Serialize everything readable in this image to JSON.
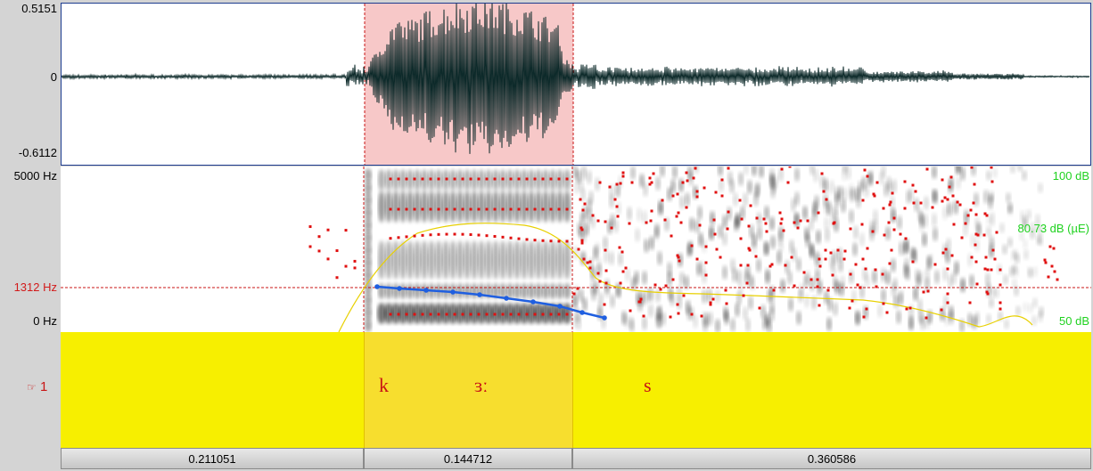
{
  "waveform": {
    "y_max": "0.5151",
    "y_zero": "0",
    "y_min": "-0.6112"
  },
  "spectrogram": {
    "freq_top": "5000 Hz",
    "freq_cursor": "1312 Hz",
    "freq_bottom": "0 Hz",
    "db_top": "100 dB",
    "db_mid": "80.73 dB (µE)",
    "db_bottom": "50 dB"
  },
  "tier": {
    "name": "1",
    "icon": "hand-pointer-icon",
    "segments": [
      "k",
      "ɜː",
      "s"
    ]
  },
  "durations": [
    "0.211051",
    "0.144712",
    "0.360586"
  ],
  "colors": {
    "selection": "#f7c8c8",
    "tier_bg": "#f7ef00",
    "tier_selected": "#f7de2e",
    "formant": "#e01010",
    "pitch": "#1f5fe0",
    "intensity": "#e8d000",
    "db_label": "#1fd21f"
  }
}
